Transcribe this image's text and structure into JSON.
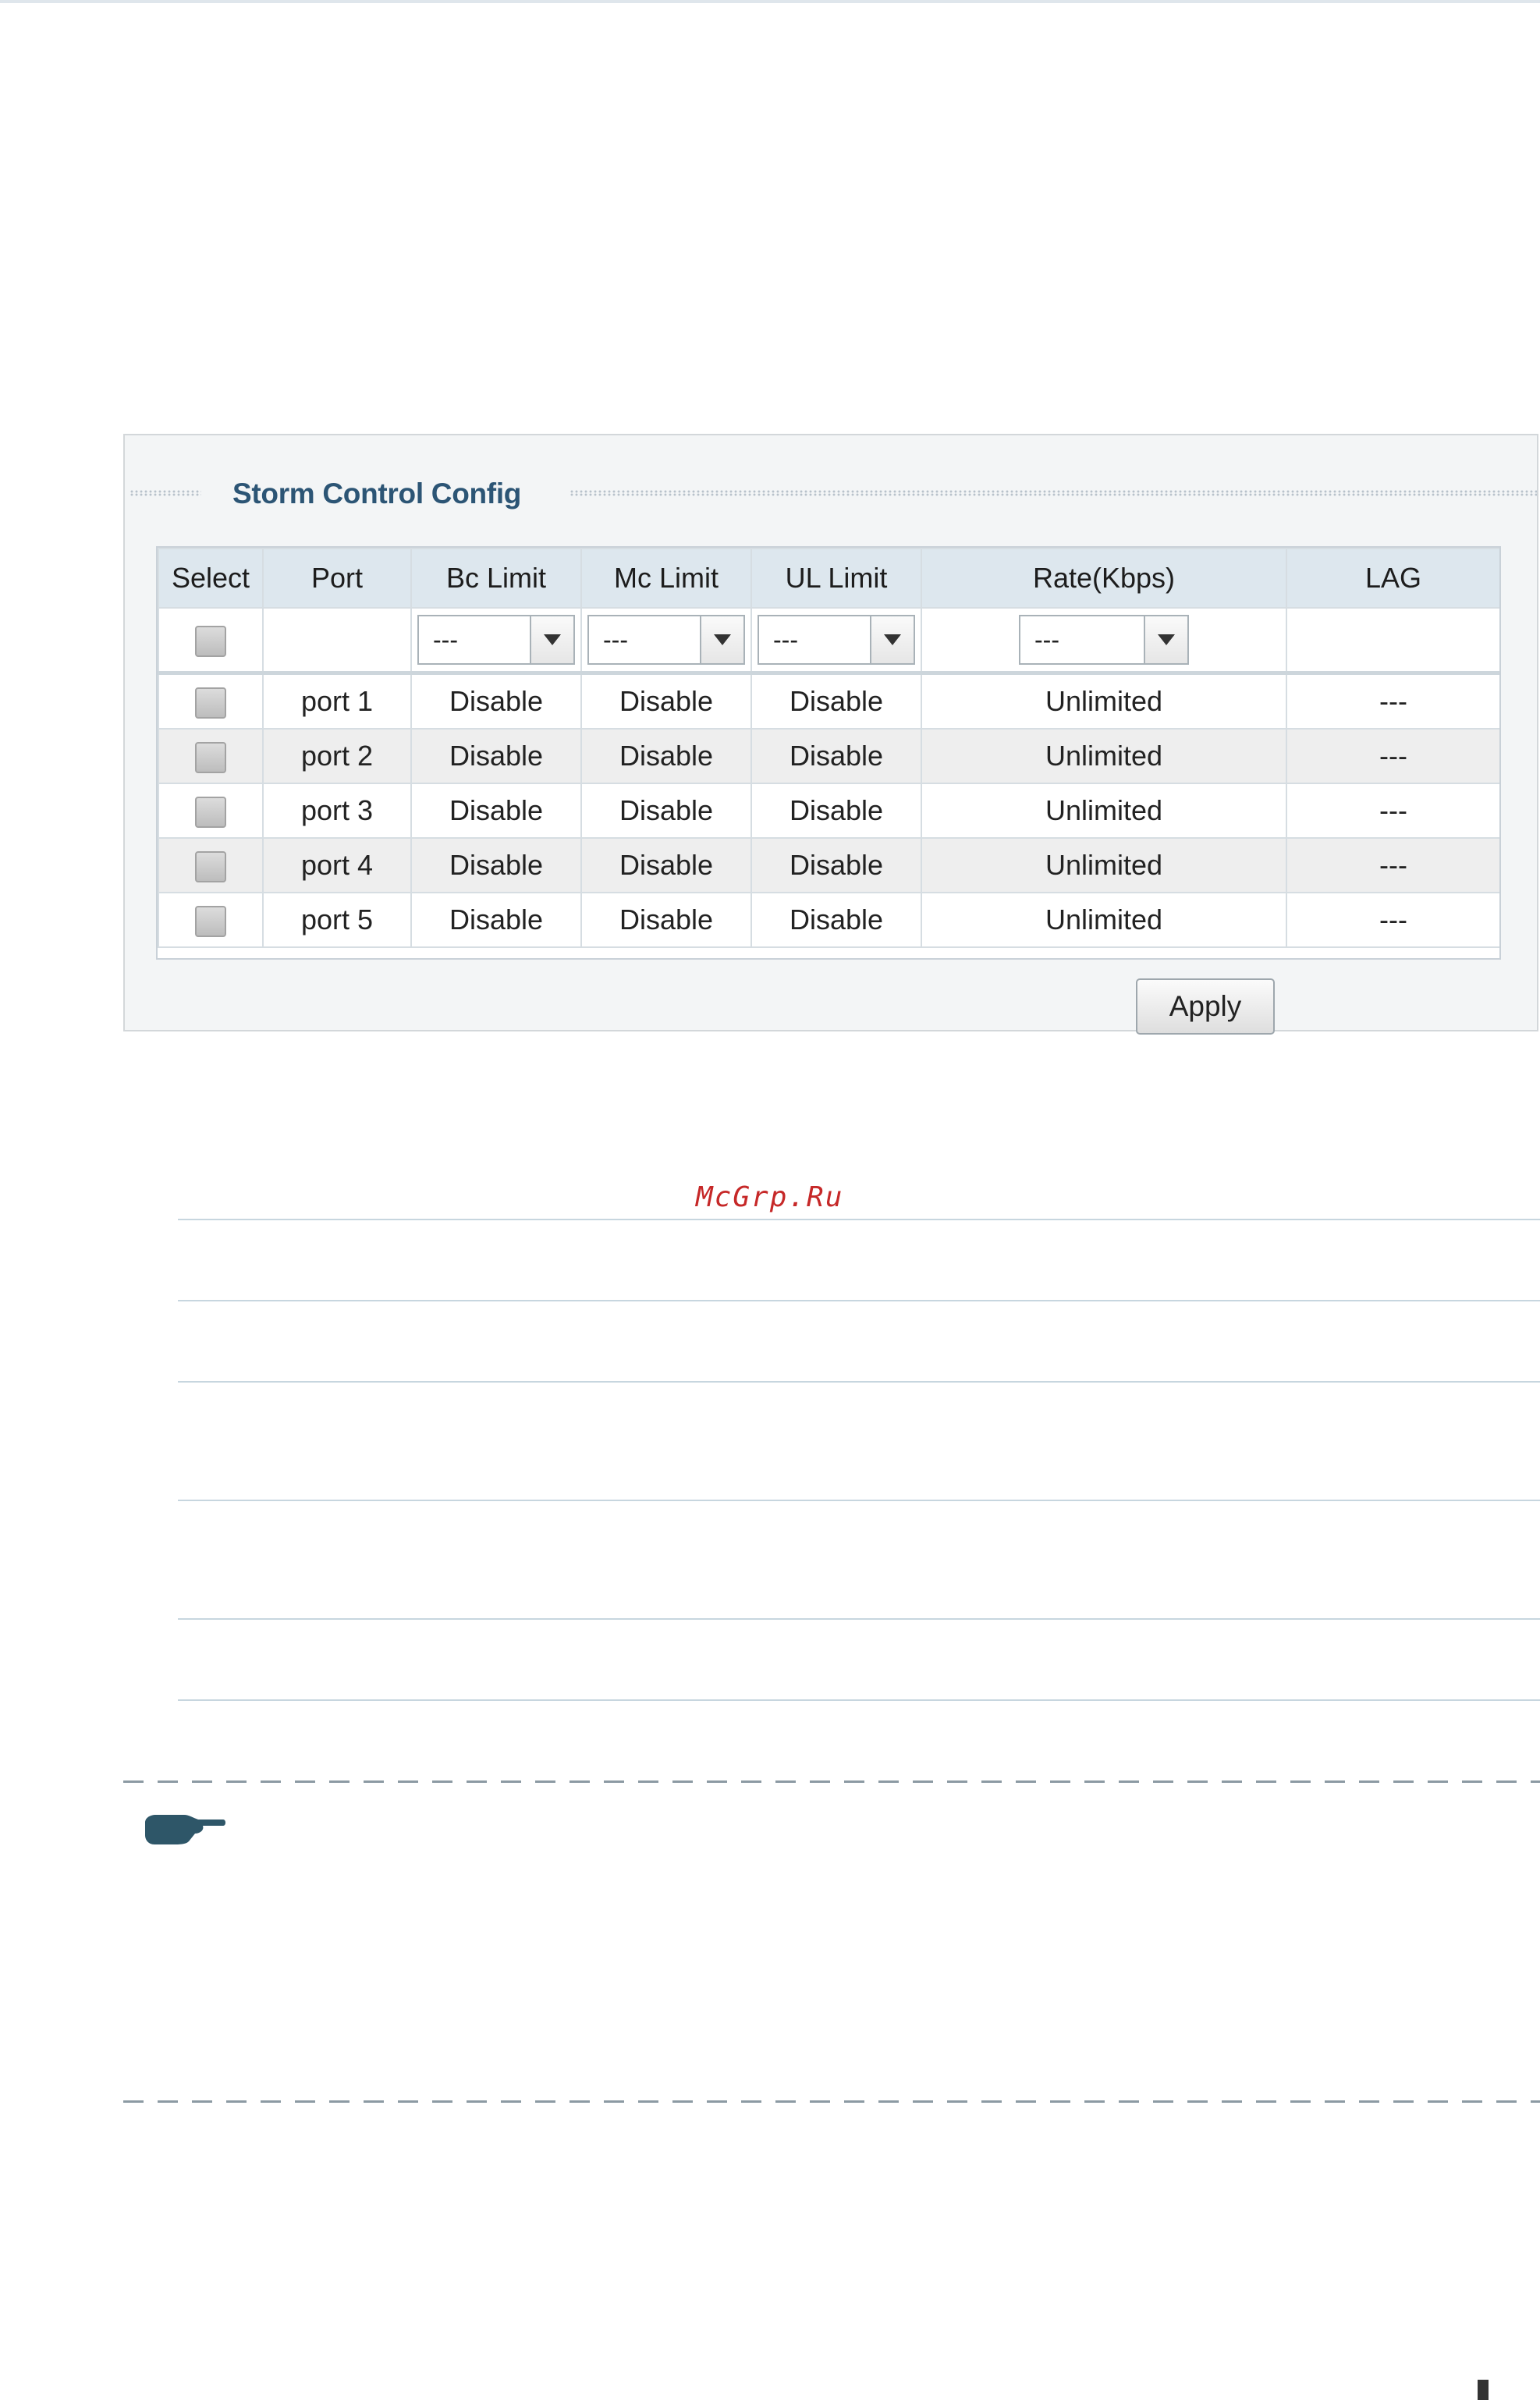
{
  "panel": {
    "title": "Storm Control Config",
    "apply_label": "Apply"
  },
  "table": {
    "headers": [
      "Select",
      "Port",
      "Bc Limit",
      "Mc Limit",
      "UL Limit",
      "Rate(Kbps)",
      "LAG"
    ],
    "filter": {
      "bc": "---",
      "mc": "---",
      "ul": "---",
      "rate": "---"
    },
    "rows": [
      {
        "port": "port 1",
        "bc": "Disable",
        "mc": "Disable",
        "ul": "Disable",
        "rate": "Unlimited",
        "lag": "---"
      },
      {
        "port": "port 2",
        "bc": "Disable",
        "mc": "Disable",
        "ul": "Disable",
        "rate": "Unlimited",
        "lag": "---"
      },
      {
        "port": "port 3",
        "bc": "Disable",
        "mc": "Disable",
        "ul": "Disable",
        "rate": "Unlimited",
        "lag": "---"
      },
      {
        "port": "port 4",
        "bc": "Disable",
        "mc": "Disable",
        "ul": "Disable",
        "rate": "Unlimited",
        "lag": "---"
      },
      {
        "port": "port 5",
        "bc": "Disable",
        "mc": "Disable",
        "ul": "Disable",
        "rate": "Unlimited",
        "lag": "---"
      }
    ]
  },
  "watermark": "McGrp.Ru",
  "icons": {
    "note": "pointing-hand-icon",
    "dropdown": "chevron-down-icon",
    "checkbox": "checkbox-icon"
  },
  "colors": {
    "title": "#2c5575",
    "header_bg": "#dde7ee",
    "alt_row": "#eeeeee",
    "watermark": "#c62828",
    "note_icon": "#2e5668"
  }
}
